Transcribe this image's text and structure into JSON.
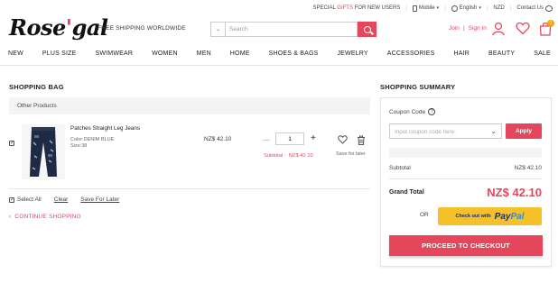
{
  "topbar": {
    "special_prefix": "SPECIAL ",
    "special_highlight": "GIFTS",
    "special_suffix": " FOR NEW USERS",
    "mobile": "Mobile",
    "language": "English",
    "currency": "NZD",
    "contact": "Contact Us"
  },
  "header": {
    "logo_text_1": "Rose",
    "logo_text_2": "gal",
    "free_shipping": "FREE SHIPPING WORLDWIDE",
    "search_placeholder": "Search",
    "join": "Join",
    "sign_in": "Sign In",
    "bag_count": "1"
  },
  "nav": {
    "items": [
      "NEW",
      "PLUS SIZE",
      "SWIMWEAR",
      "WOMEN",
      "MEN",
      "HOME",
      "SHOES & BAGS",
      "JEWELRY",
      "ACCESSORIES",
      "HAIR",
      "BEAUTY",
      "SALE"
    ]
  },
  "bag": {
    "title": "SHOPPING BAG",
    "section": "Other Products",
    "item": {
      "name": "Patches Straight Leg Jeans",
      "color": "Color:DENIM BLUE",
      "size": "Size:38",
      "price": "NZ$ 42.10",
      "quantity": "1",
      "subtotal": "Subtotal :  NZ$ 42.10",
      "save_label": "Save for later"
    },
    "select_all": "Select All",
    "clear": "Clear",
    "save_for_later": "Save For Later",
    "continue": "CONTINUE SHOPPING"
  },
  "summary": {
    "title": "SHOPPING SUMMARY",
    "coupon_label": "Coupon Code",
    "coupon_placeholder": "Input coupon code here:",
    "apply": "Apply",
    "subtotal_label": "Subtotal",
    "subtotal_value": "NZ$ 42.10",
    "grand_total_label": "Grand Total",
    "grand_total_value": "NZ$ 42.10",
    "or": "OR",
    "paypal_prefix": "Check out with",
    "paypal_1": "Pay",
    "paypal_2": "Pal",
    "checkout": "PROCEED TO CHECKOUT"
  },
  "colors": {
    "accent": "#e6465b",
    "paypal_yellow": "#f5c02a"
  }
}
